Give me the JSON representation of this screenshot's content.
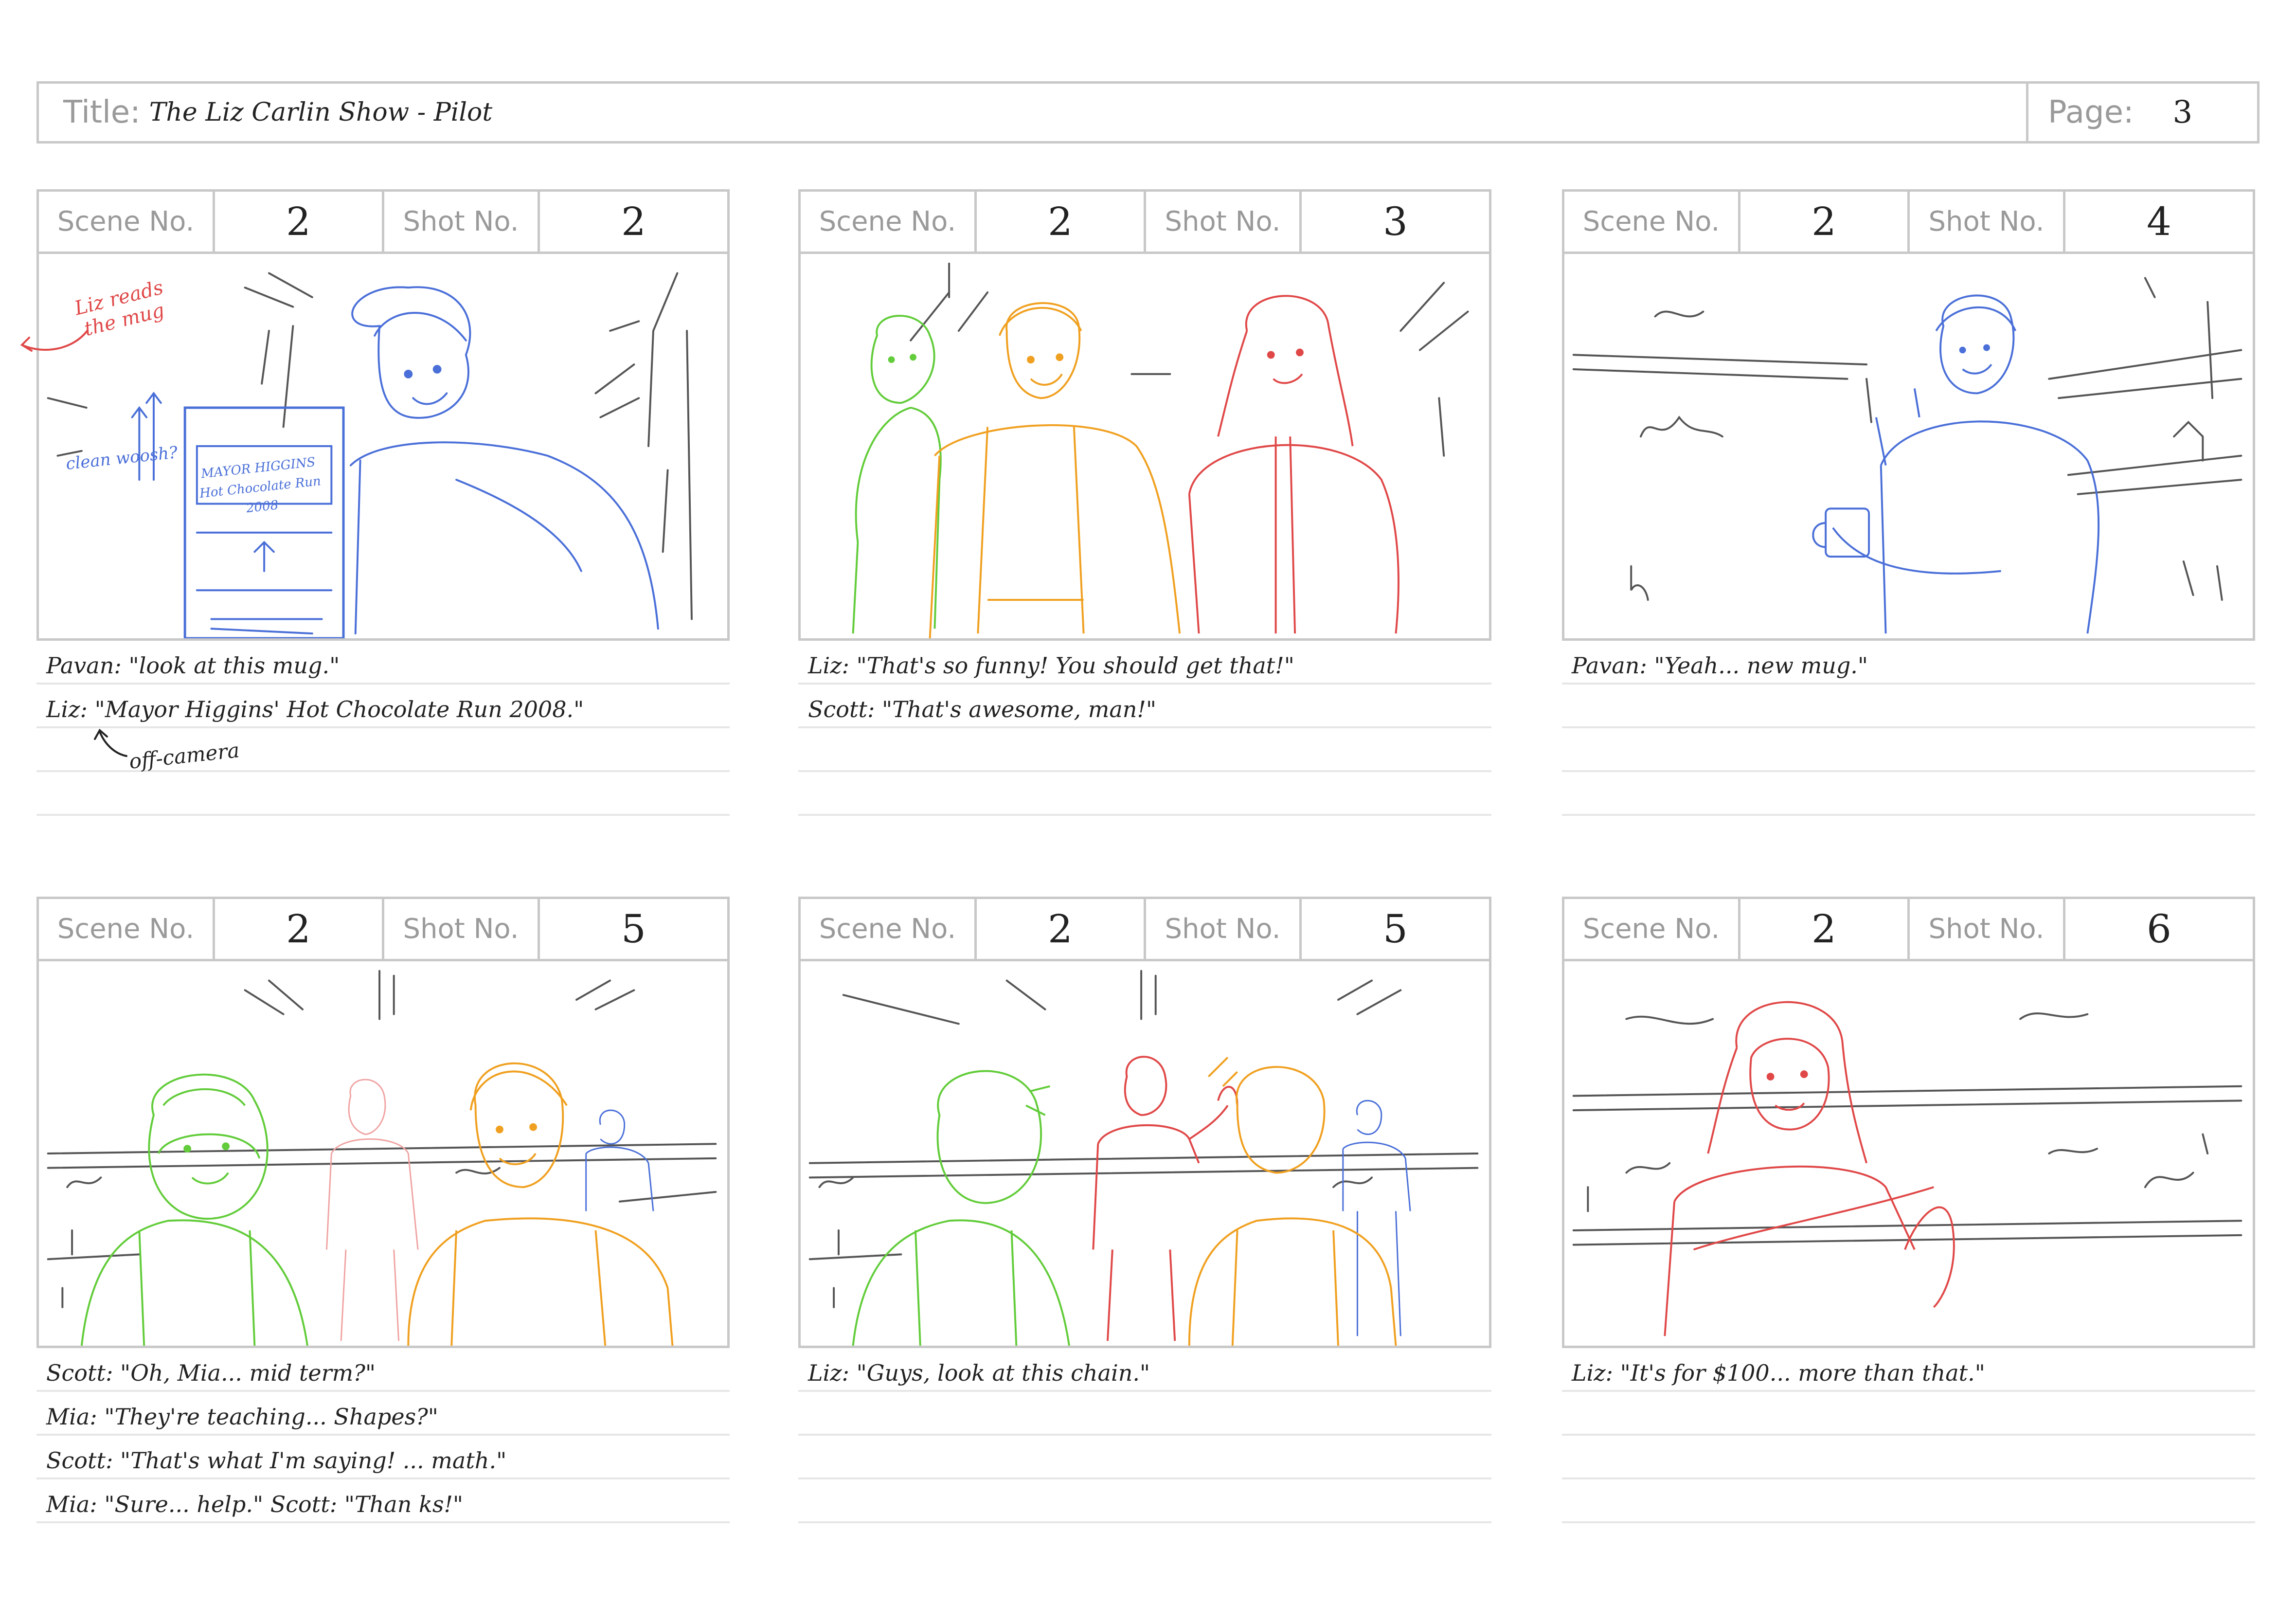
{
  "header": {
    "title_label": "Title:",
    "title": "The Liz Carlin Show - Pilot",
    "page_label": "Page:",
    "page": "3"
  },
  "panels": [
    {
      "scene_label": "Scene No.",
      "scene": "2",
      "shot_label": "Shot No.",
      "shot": "2",
      "lines": [
        "Pavan: \"look at this mug.\"",
        "Liz: \"Mayor Higgins' Hot Chocolate Run 2008.\"",
        "",
        ""
      ],
      "notes": {
        "red": "Liz reads the mug",
        "blue": "clean woosh?",
        "offcam": "off-camera",
        "mug_text": "MAYOR HIGGINS Hot Chocolate Run 2008"
      }
    },
    {
      "scene_label": "Scene No.",
      "scene": "2",
      "shot_label": "Shot No.",
      "shot": "3",
      "lines": [
        "Liz: \"That's so funny! You should get that!\"",
        "Scott: \"That's awesome, man!\"",
        "",
        ""
      ]
    },
    {
      "scene_label": "Scene No.",
      "scene": "2",
      "shot_label": "Shot No.",
      "shot": "4",
      "lines": [
        "Pavan: \"Yeah... new mug.\"",
        "",
        "",
        ""
      ]
    },
    {
      "scene_label": "Scene No.",
      "scene": "2",
      "shot_label": "Shot No.",
      "shot": "5",
      "lines": [
        "Scott: \"Oh, Mia... mid term?\"",
        "Mia: \"They're teaching... Shapes?\"",
        "Scott: \"That's what I'm saying! ... math.\"",
        "Mia: \"Sure... help.\"   Scott: \"Than ks!\""
      ]
    },
    {
      "scene_label": "Scene No.",
      "scene": "2",
      "shot_label": "Shot No.",
      "shot": "5",
      "lines": [
        "Liz: \"Guys, look at this chain.\"",
        "",
        "",
        ""
      ]
    },
    {
      "scene_label": "Scene No.",
      "scene": "2",
      "shot_label": "Shot No.",
      "shot": "6",
      "lines": [
        "Liz: \"It's for $100... more than that.\"",
        "",
        "",
        ""
      ]
    }
  ],
  "colors": {
    "pavan": "#4a6fd8",
    "liz": "#e04848",
    "scott": "#f0a020",
    "mia": "#62cc3a",
    "sketch": "#555555",
    "frame_border": "#c8c8c8"
  }
}
